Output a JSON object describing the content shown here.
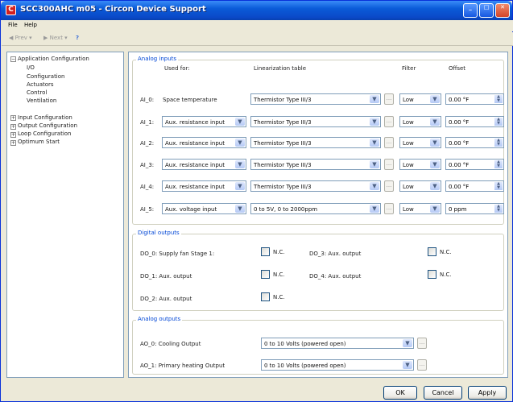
{
  "window": {
    "title": "SCC300AHC m05 - Circon Device Support",
    "app_icon_glyph": "C"
  },
  "menu": [
    {
      "label": "File",
      "underline": "F"
    },
    {
      "label": "Help",
      "underline": "H"
    }
  ],
  "toolbar": {
    "prev": "Prev",
    "next": "Next",
    "help_icon": "help-icon"
  },
  "tree": {
    "root": "Application Configuration",
    "children": [
      "I/O",
      "Configuration",
      "Actuators",
      "Control",
      "Ventilation"
    ],
    "siblings": [
      "Input Configuration",
      "Output Configuration",
      "Loop Configuration",
      "Optimum Start"
    ]
  },
  "analog_inputs": {
    "legend": "Analog inputs",
    "headers": {
      "used_for": "Used for:",
      "lin_table": "Linearization table",
      "filter": "Filter",
      "offset": "Offset"
    },
    "rows": [
      {
        "id": "AI_0:",
        "used_for": "Space temperature",
        "lin": "Thermistor Type III/3",
        "filter": "Low",
        "offset": "0.00 °F"
      },
      {
        "id": "AI_1:",
        "used_for": "Aux. resistance input",
        "lin": "Thermistor Type III/3",
        "filter": "Low",
        "offset": "0.00 °F"
      },
      {
        "id": "AI_2:",
        "used_for": "Aux. resistance input",
        "lin": "Thermistor Type III/3",
        "filter": "Low",
        "offset": "0.00 °F"
      },
      {
        "id": "AI_3:",
        "used_for": "Aux. resistance input",
        "lin": "Thermistor Type III/3",
        "filter": "Low",
        "offset": "0.00 °F"
      },
      {
        "id": "AI_4:",
        "used_for": "Aux. resistance input",
        "lin": "Thermistor Type III/3",
        "filter": "Low",
        "offset": "0.00 °F"
      },
      {
        "id": "AI_5:",
        "used_for": "Aux. voltage input",
        "lin": "0 to 5V, 0 to 2000ppm",
        "filter": "Low",
        "offset": "0 ppm"
      }
    ]
  },
  "digital_outputs": {
    "legend": "Digital outputs",
    "items": [
      {
        "label": "DO_0: Supply fan Stage 1:",
        "check_label": "N.C."
      },
      {
        "label": "DO_1: Aux. output",
        "check_label": "N.C."
      },
      {
        "label": "DO_2: Aux. output",
        "check_label": "N.C."
      },
      {
        "label": "DO_3: Aux. output",
        "check_label": "N.C."
      },
      {
        "label": "DO_4: Aux. output",
        "check_label": "N.C."
      }
    ]
  },
  "analog_outputs": {
    "legend": "Analog outputs",
    "items": [
      {
        "label": "AO_0: Cooling Output",
        "value": "0 to 10 Volts (powered open)"
      },
      {
        "label": "AO_1: Primary heating Output",
        "value": "0 to 10 Volts (powered open)"
      }
    ]
  },
  "buttons": {
    "ok": "OK",
    "cancel": "Cancel",
    "apply": "Apply"
  }
}
